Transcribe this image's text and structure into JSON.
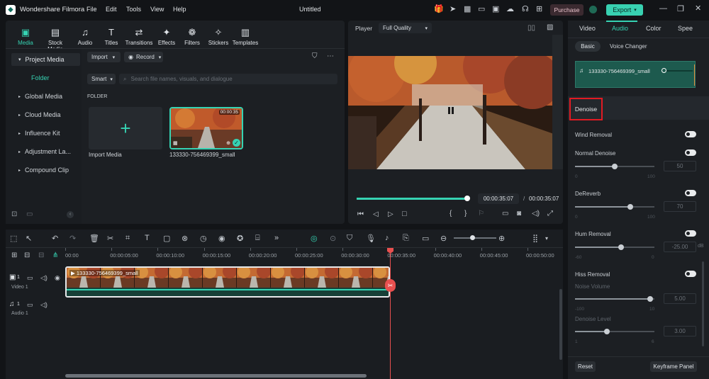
{
  "app": {
    "name": "Wondershare Filmora",
    "title": "Untitled",
    "purchase": "Purchase",
    "export": "Export"
  },
  "menu": [
    "File",
    "Edit",
    "Tools",
    "View",
    "Help"
  ],
  "media_tabs": [
    "Media",
    "Stock Media",
    "Audio",
    "Titles",
    "Transitions",
    "Effects",
    "Filters",
    "Stickers",
    "Templates"
  ],
  "sidebar": {
    "project_media": "Project Media",
    "folder": "Folder",
    "items": [
      "Global Media",
      "Cloud Media",
      "Influence Kit",
      "Adjustment La...",
      "Compound Clip"
    ]
  },
  "toolbar": {
    "import": "Import",
    "record": "Record",
    "sort": "Smart",
    "search_placeholder": "Search file names, visuals, and dialogue",
    "folder_label": "FOLDER"
  },
  "media_items": {
    "import_label": "Import Media",
    "clip_name": "133330-756469399_small",
    "clip_duration": "00:00:35"
  },
  "player": {
    "label": "Player",
    "quality": "Full Quality",
    "current": "00:00:35:07",
    "separator": "/",
    "total": "00:00:35:07",
    "progress": 1.0
  },
  "right_panel": {
    "tabs": [
      "Video",
      "Audio",
      "Color",
      "Spee"
    ],
    "subtabs": [
      "Basic",
      "Voice Changer"
    ],
    "clip": "133330-756469399_small",
    "section": "Denoise",
    "wind": "Wind Removal",
    "normal": {
      "label": "Normal Denoise",
      "value": "50",
      "min": "0",
      "max": "100",
      "level": 0.5
    },
    "dereverb": {
      "label": "DeReverb",
      "value": "70",
      "min": "0",
      "max": "100",
      "level": 0.7
    },
    "hum": {
      "label": "Hum Removal",
      "value": "-25.00",
      "unit": "dB",
      "min": "-60",
      "max": "0",
      "level": 0.58
    },
    "hiss": {
      "label": "Hiss Removal",
      "volume_label": "Noise Volume",
      "volume_value": "5.00",
      "volume_min": "-100",
      "volume_max": "10",
      "volume_level": 0.95,
      "level_label": "Denoise Level",
      "level_value": "3.00",
      "level_min": "1",
      "level_max": "6",
      "level_level": 0.4
    },
    "reset": "Reset",
    "keyframe": "Keyframe Panel"
  },
  "timeline": {
    "ruler": [
      "00:00",
      "00:00:05:00",
      "00:00:10:00",
      "00:00:15:00",
      "00:00:20:00",
      "00:00:25:00",
      "00:00:30:00",
      "00:00:35:00",
      "00:00:40:00",
      "00:00:45:00",
      "00:00:50:00"
    ],
    "track_video": "Video 1",
    "track_audio": "Audio 1",
    "clip": "133330-756469399_small"
  },
  "colors": {
    "accent": "#36d3b3",
    "playhead": "#e8504f",
    "highlight": "#e21b23"
  }
}
